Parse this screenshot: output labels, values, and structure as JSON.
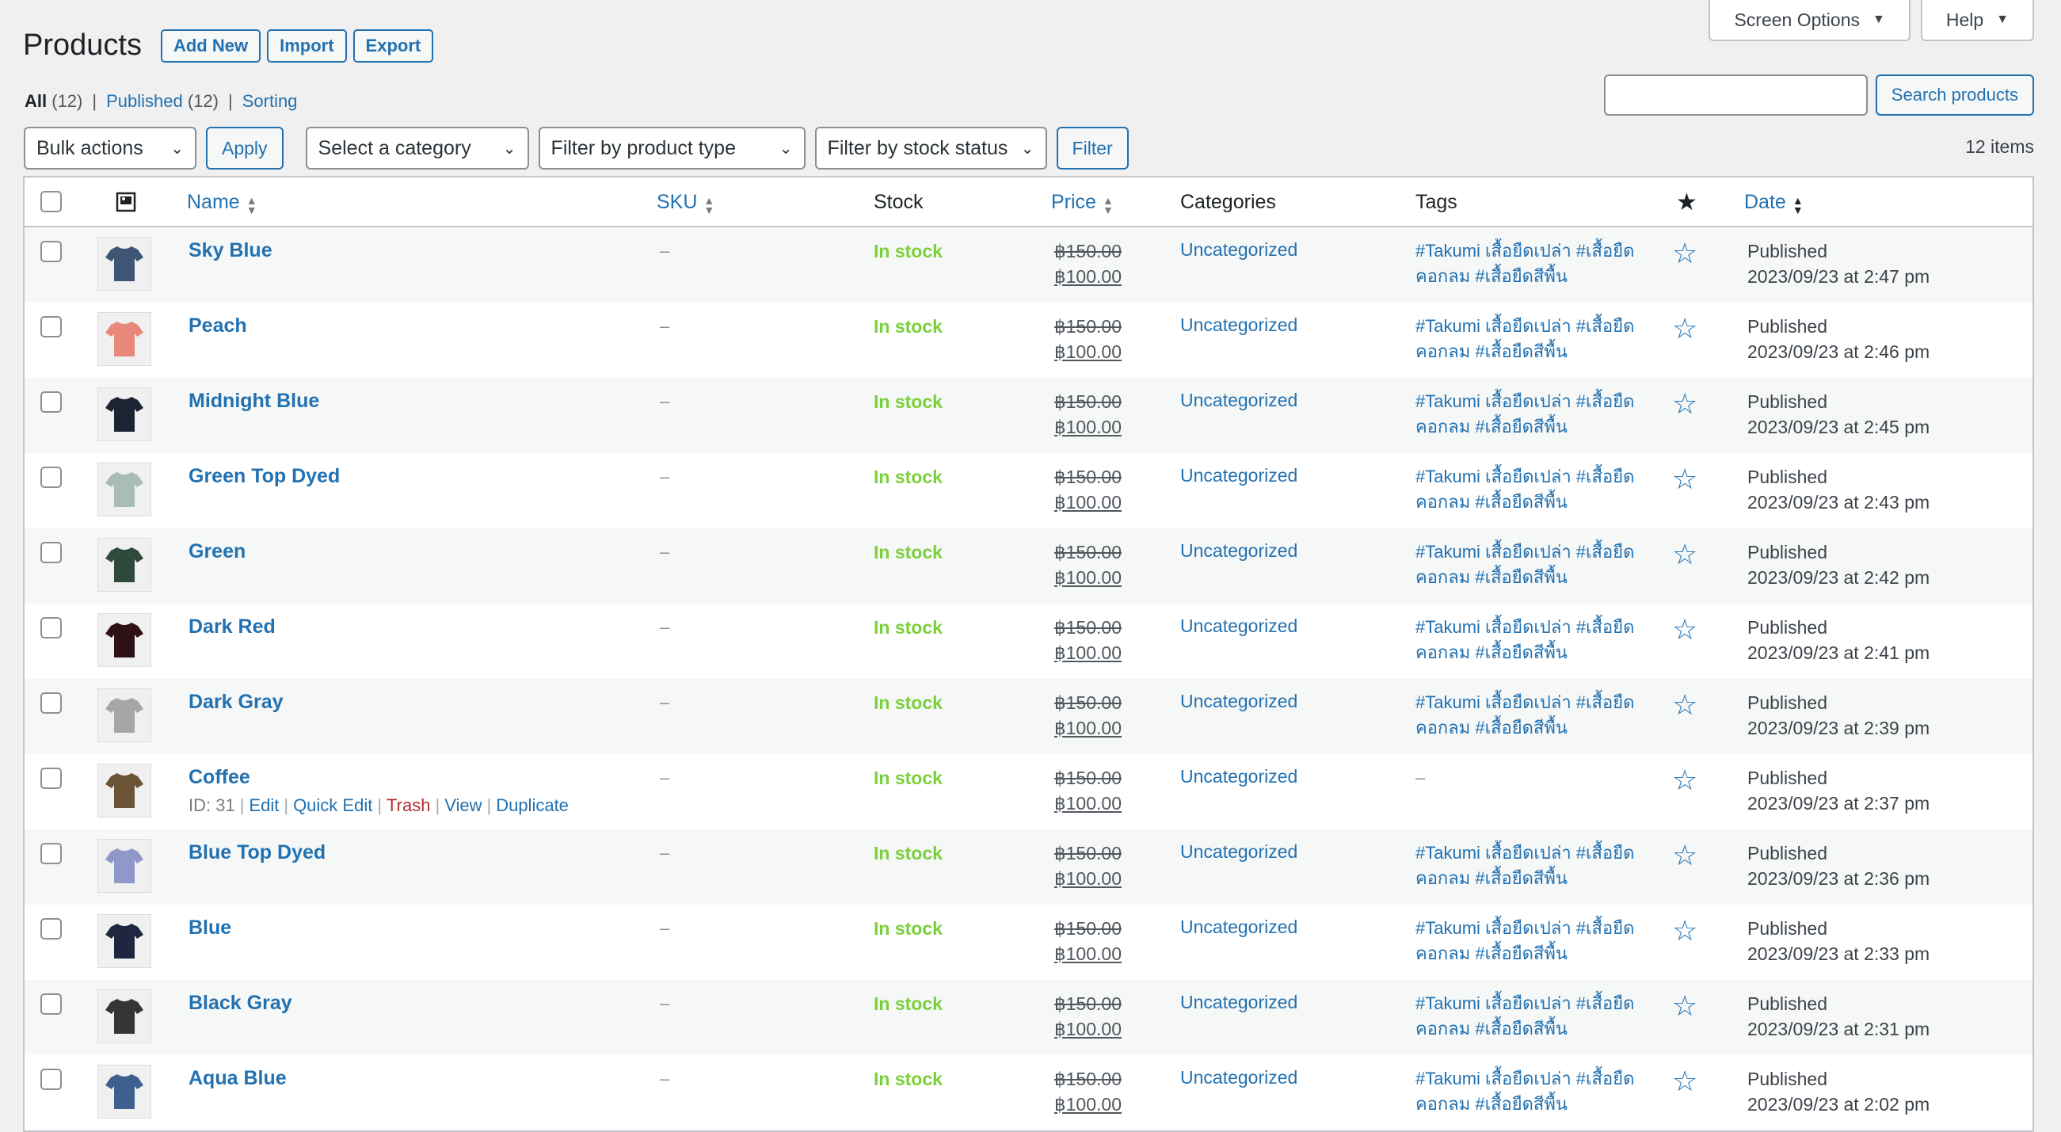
{
  "page": {
    "title": "Products",
    "actions": [
      "Add New",
      "Import",
      "Export"
    ],
    "screen_options_label": "Screen Options",
    "help_label": "Help"
  },
  "views": {
    "all_label": "All",
    "all_count": "(12)",
    "published_label": "Published",
    "published_count": "(12)",
    "sorting_label": "Sorting"
  },
  "search": {
    "placeholder": "",
    "button_label": "Search products"
  },
  "filters": {
    "bulk_actions": "Bulk actions",
    "apply_label": "Apply",
    "category": "Select a category",
    "product_type": "Filter by product type",
    "stock_status": "Filter by stock status",
    "filter_label": "Filter",
    "items_count": "12 items"
  },
  "columns": {
    "name": "Name",
    "sku": "SKU",
    "stock": "Stock",
    "price": "Price",
    "categories": "Categories",
    "tags": "Tags",
    "date": "Date"
  },
  "rows": [
    {
      "name": "Sky Blue",
      "color": "#3e5576",
      "sku": "–",
      "stock": "In stock",
      "old_price": "฿150.00",
      "new_price": "฿100.00",
      "category": "Uncategorized",
      "tags": "#Takumi  เสื้อยืดเปล่า #เสื้อยืดคอกลม #เสื้อยืดสีพื้น",
      "status": "Published",
      "date": "2023/09/23 at 2:47 pm"
    },
    {
      "name": "Peach",
      "color": "#e8887a",
      "sku": "–",
      "stock": "In stock",
      "old_price": "฿150.00",
      "new_price": "฿100.00",
      "category": "Uncategorized",
      "tags": "#Takumi  เสื้อยืดเปล่า #เสื้อยืดคอกลม #เสื้อยืดสีพื้น",
      "status": "Published",
      "date": "2023/09/23 at 2:46 pm"
    },
    {
      "name": "Midnight Blue",
      "color": "#1c2333",
      "sku": "–",
      "stock": "In stock",
      "old_price": "฿150.00",
      "new_price": "฿100.00",
      "category": "Uncategorized",
      "tags": "#Takumi  เสื้อยืดเปล่า #เสื้อยืดคอกลม #เสื้อยืดสีพื้น",
      "status": "Published",
      "date": "2023/09/23 at 2:45 pm"
    },
    {
      "name": "Green Top Dyed",
      "color": "#a9bdb6",
      "sku": "–",
      "stock": "In stock",
      "old_price": "฿150.00",
      "new_price": "฿100.00",
      "category": "Uncategorized",
      "tags": "#Takumi  เสื้อยืดเปล่า #เสื้อยืดคอกลม #เสื้อยืดสีพื้น",
      "status": "Published",
      "date": "2023/09/23 at 2:43 pm"
    },
    {
      "name": "Green",
      "color": "#2f4a3c",
      "sku": "–",
      "stock": "In stock",
      "old_price": "฿150.00",
      "new_price": "฿100.00",
      "category": "Uncategorized",
      "tags": "#Takumi  เสื้อยืดเปล่า #เสื้อยืดคอกลม #เสื้อยืดสีพื้น",
      "status": "Published",
      "date": "2023/09/23 at 2:42 pm"
    },
    {
      "name": "Dark Red",
      "color": "#2e1116",
      "sku": "–",
      "stock": "In stock",
      "old_price": "฿150.00",
      "new_price": "฿100.00",
      "category": "Uncategorized",
      "tags": "#Takumi  เสื้อยืดเปล่า #เสื้อยืดคอกลม #เสื้อยืดสีพื้น",
      "status": "Published",
      "date": "2023/09/23 at 2:41 pm"
    },
    {
      "name": "Dark Gray",
      "color": "#a6a6a4",
      "sku": "–",
      "stock": "In stock",
      "old_price": "฿150.00",
      "new_price": "฿100.00",
      "category": "Uncategorized",
      "tags": "#Takumi  เสื้อยืดเปล่า #เสื้อยืดคอกลม #เสื้อยืดสีพื้น",
      "status": "Published",
      "date": "2023/09/23 at 2:39 pm"
    },
    {
      "name": "Coffee",
      "color": "#6b5436",
      "sku": "–",
      "stock": "In stock",
      "old_price": "฿150.00",
      "new_price": "฿100.00",
      "category": "Uncategorized",
      "tags": "–",
      "status": "Published",
      "date": "2023/09/23 at 2:37 pm",
      "row_actions": {
        "id": "ID: 31",
        "edit": "Edit",
        "quick_edit": "Quick Edit",
        "trash": "Trash",
        "view": "View",
        "duplicate": "Duplicate"
      }
    },
    {
      "name": "Blue Top Dyed",
      "color": "#8f98c8",
      "sku": "–",
      "stock": "In stock",
      "old_price": "฿150.00",
      "new_price": "฿100.00",
      "category": "Uncategorized",
      "tags": "#Takumi  เสื้อยืดเปล่า #เสื้อยืดคอกลม #เสื้อยืดสีพื้น",
      "status": "Published",
      "date": "2023/09/23 at 2:36 pm"
    },
    {
      "name": "Blue",
      "color": "#1f2740",
      "sku": "–",
      "stock": "In stock",
      "old_price": "฿150.00",
      "new_price": "฿100.00",
      "category": "Uncategorized",
      "tags": "#Takumi  เสื้อยืดเปล่า #เสื้อยืดคอกลม #เสื้อยืดสีพื้น",
      "status": "Published",
      "date": "2023/09/23 at 2:33 pm"
    },
    {
      "name": "Black Gray",
      "color": "#333536",
      "sku": "–",
      "stock": "In stock",
      "old_price": "฿150.00",
      "new_price": "฿100.00",
      "category": "Uncategorized",
      "tags": "#Takumi  เสื้อยืดเปล่า #เสื้อยืดคอกลม #เสื้อยืดสีพื้น",
      "status": "Published",
      "date": "2023/09/23 at 2:31 pm"
    },
    {
      "name": "Aqua Blue",
      "color": "#3f5f8e",
      "sku": "–",
      "stock": "In stock",
      "old_price": "฿150.00",
      "new_price": "฿100.00",
      "category": "Uncategorized",
      "tags": "#Takumi  เสื้อยืดเปล่า #เสื้อยืดคอกลม #เสื้อยืดสีพื้น",
      "status": "Published",
      "date": "2023/09/23 at 2:02 pm"
    }
  ],
  "theme": {
    "link": "#2271b1",
    "in_stock": "#7ad03a",
    "trash": "#b32d2e"
  }
}
